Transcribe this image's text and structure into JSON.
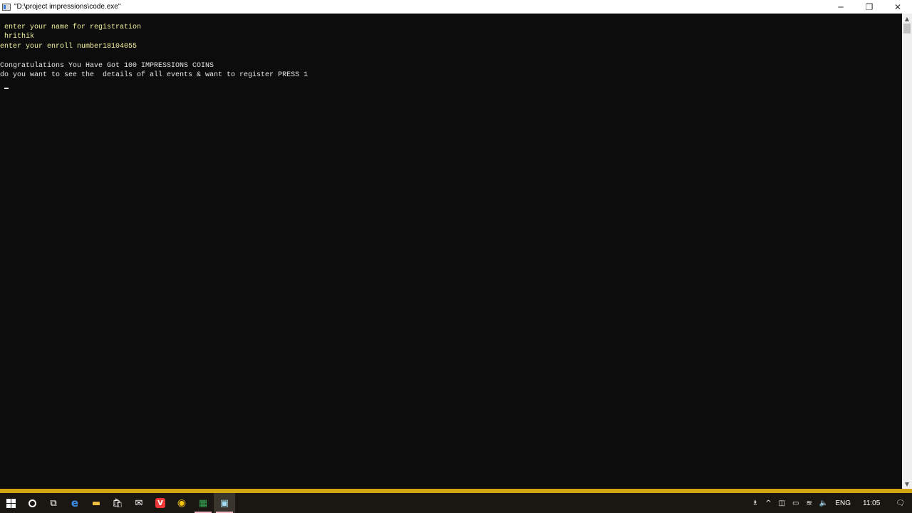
{
  "window": {
    "title": "\"D:\\project impressions\\code.exe\"",
    "controls": {
      "minimize": "─",
      "restore": "❐",
      "close": "✕"
    }
  },
  "console": {
    "lines": [
      " enter your name for registration",
      " hrithik",
      "enter your enroll number18104055",
      "",
      "Congratulations You Have Got 100 IMPRESSIONS COINS",
      "do you want to see the  details of all events & want to register PRESS 1"
    ]
  },
  "scrollbar": {
    "up": "▲",
    "down": "▼"
  },
  "taskbar": {
    "icons": [
      {
        "name": "start-windows-icon"
      },
      {
        "name": "cortana-circle-icon",
        "glyph": ""
      },
      {
        "name": "task-view-icon",
        "glyph": "⧉"
      },
      {
        "name": "edge-browser-icon",
        "glyph": "e",
        "color": "#3b8ee8"
      },
      {
        "name": "file-explorer-icon",
        "glyph": "▬",
        "color": "#f0c040"
      },
      {
        "name": "store-icon",
        "glyph": "🛍"
      },
      {
        "name": "mail-icon",
        "glyph": "✉"
      },
      {
        "name": "vivaldi-icon",
        "glyph": "V",
        "color": "#ef3939"
      },
      {
        "name": "chrome-icon",
        "glyph": "◉",
        "color": "#f4c20d"
      },
      {
        "name": "app-colorful-icon",
        "glyph": "▦",
        "color": "#34a853"
      },
      {
        "name": "console-app-icon",
        "glyph": "▣",
        "color": "#9fd8f0"
      }
    ],
    "tray": {
      "people": "♗",
      "chevron": "^",
      "keyboard": "◫",
      "battery": "▭",
      "wifi": "≋",
      "volume": "🔈",
      "language": "ENG",
      "time": "11:05",
      "notifications": "🗨"
    }
  }
}
